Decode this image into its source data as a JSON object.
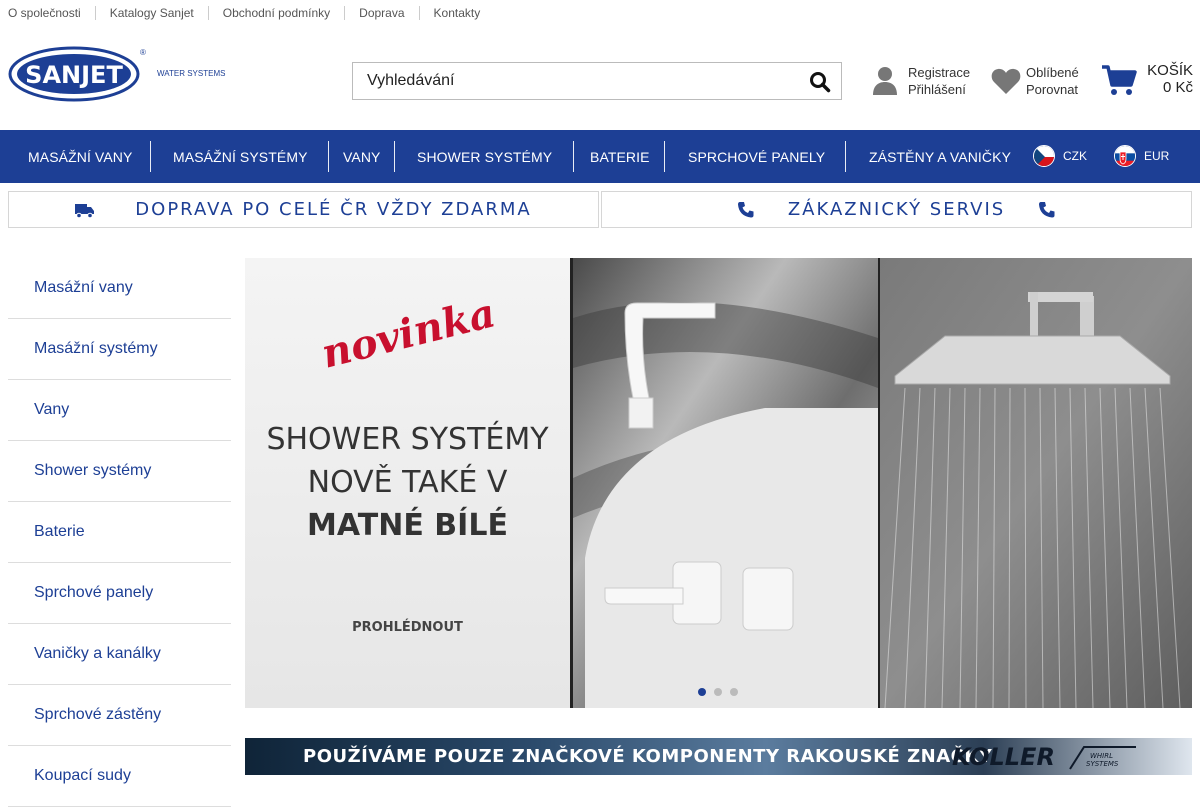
{
  "top_links": [
    "O společnosti",
    "Katalogy Sanjet",
    "Obchodní podmínky",
    "Doprava",
    "Kontakty"
  ],
  "logo": {
    "brand": "SANJET",
    "tagline": "WATER SYSTEMS"
  },
  "search": {
    "placeholder": "Vyhledávání"
  },
  "account": {
    "register": "Registrace",
    "login": "Přihlášení"
  },
  "favorites": {
    "favorites": "Oblíbené",
    "compare": "Porovnat"
  },
  "cart": {
    "label": "KOŠÍK",
    "total": "0 Kč"
  },
  "nav": {
    "items": [
      "MASÁŽNÍ VANY",
      "MASÁŽNÍ SYSTÉMY",
      "VANY",
      "SHOWER SYSTÉMY",
      "BATERIE",
      "SPRCHOVÉ PANELY",
      "ZÁSTĚNY A VANIČKY"
    ],
    "currencies": [
      "CZK",
      "EUR"
    ]
  },
  "promo": {
    "shipping": "DOPRAVA PO CELÉ ČR VŽDY ZDARMA",
    "service": "ZÁKAZNICKÝ SERVIS"
  },
  "sidebar": [
    "Masážní vany",
    "Masážní systémy",
    "Vany",
    "Shower systémy",
    "Baterie",
    "Sprchové panely",
    "Vaničky a kanálky",
    "Sprchové zástěny",
    "Koupací sudy"
  ],
  "banner": {
    "tag": "novinka",
    "line1": "SHOWER SYSTÉMY",
    "line2": "NOVĚ TAKÉ V",
    "line3": "MATNÉ BÍLÉ",
    "cta": "PROHLÉDNOUT",
    "slides": 3,
    "active_slide": 1
  },
  "koller": {
    "text": "POUŽÍVÁME POUZE ZNAČKOVÉ KOMPONENTY RAKOUSKÉ ZNAČKY",
    "brand": "KOLLER",
    "brand_sub": "WHIRL SYSTEMS"
  },
  "colors": {
    "brand_blue": "#1d3f95",
    "accent_red": "#c8102e"
  }
}
